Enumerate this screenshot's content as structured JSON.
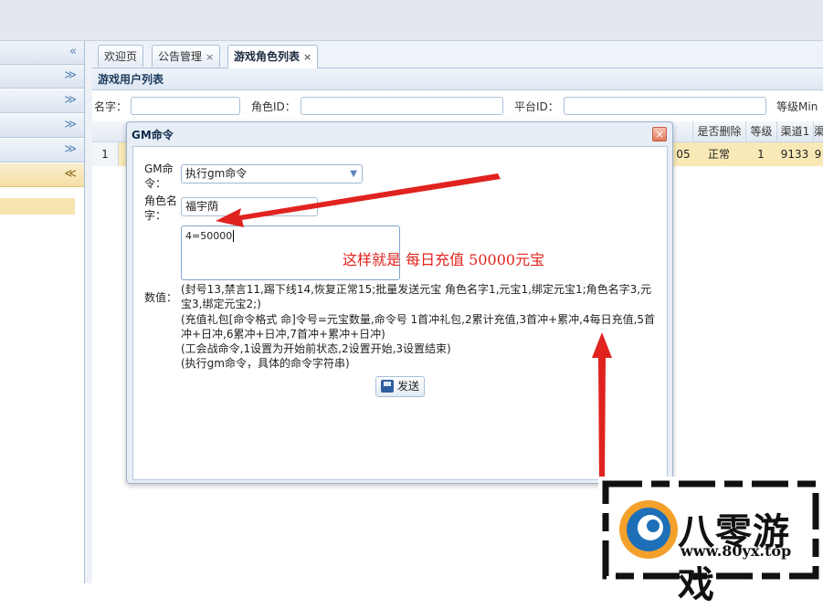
{
  "tabs": [
    {
      "label": "欢迎页"
    },
    {
      "label": "公告管理",
      "close": "×"
    },
    {
      "label": "游戏角色列表",
      "close": "×"
    }
  ],
  "panel": {
    "title": "游戏用户列表"
  },
  "filters": {
    "name_label": "名字：",
    "role_id_label": "角色ID：",
    "platform_id_label": "平台ID：",
    "level_min_label": "等级Min"
  },
  "grid": {
    "headers": [
      "是否删除",
      "等级",
      "渠道1",
      "渠"
    ],
    "row": {
      "num": "1",
      "partial": "05",
      "deleted": "正常",
      "level": "1",
      "channel1": "9133",
      "channel2": "9"
    }
  },
  "dialog": {
    "title": "GM命令",
    "close": "×",
    "gm_label": "GM命令：",
    "gm_selected": "执行gm命令",
    "role_label": "角色名字：",
    "role_value": "福宇荫",
    "value_label": "数值：",
    "value_text": "4=50000",
    "help": [
      "(封号13,禁言11,踢下线14,恢复正常15;批量发送元宝 角色名字1,元宝1,绑定元宝1;角色名字3,元宝3,绑定元宝2;)",
      "(充值礼包[命令格式 命]令号=元宝数量,命令号 1首冲礼包,2累计充值,3首冲+累冲,4每日充值,5首冲+日冲,6累冲+日冲,7首冲+累冲+日冲)",
      "(工会战命令,1设置为开始前状态,2设置开始,3设置结束)",
      "(执行gm命令，具体的命令字符串)"
    ],
    "send_label": "发送"
  },
  "annotation": "这样就是  每日充值  50000元宝",
  "watermark": {
    "brand": "八零游戏",
    "url": "www.80yx.top"
  },
  "colors": {
    "arrow": "#e0231f",
    "selected_row": "#f9e9b6",
    "accent": "#5b85b8"
  },
  "icons": [
    "collapse-left-icon",
    "expand-down-icon",
    "collapse-up-icon",
    "close-icon",
    "dropdown-arrow-icon",
    "save-icon"
  ]
}
